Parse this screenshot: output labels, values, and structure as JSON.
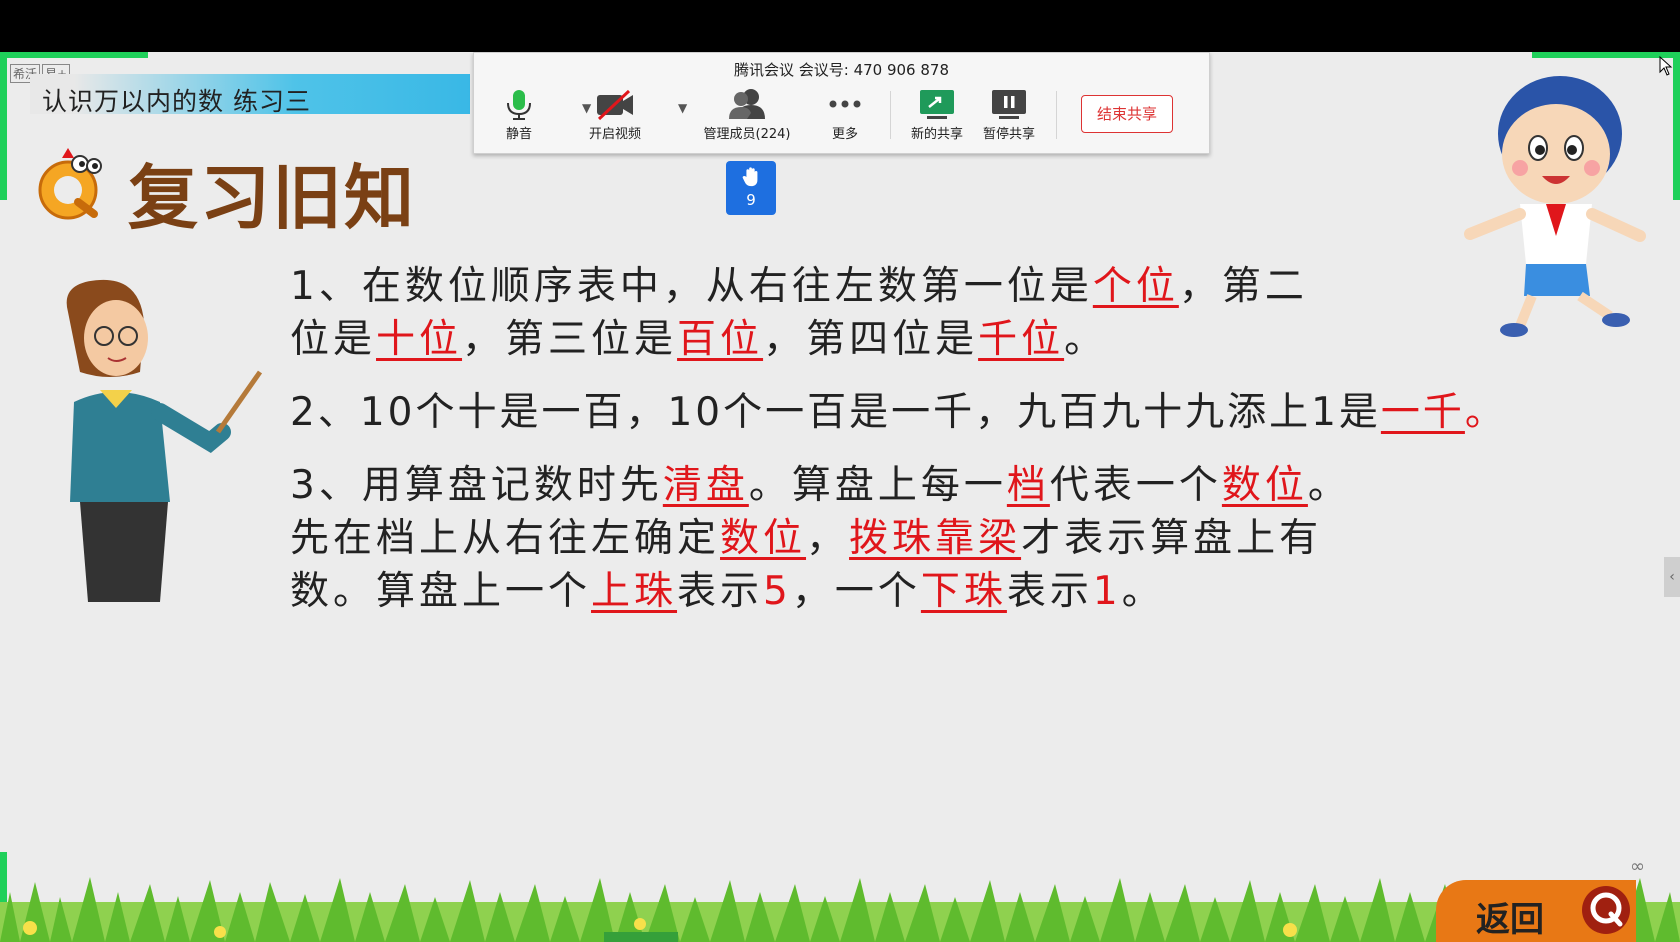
{
  "slide": {
    "logo_text": "希沃",
    "logo_badge": "易+",
    "lesson_title": "认识万以内的数  练习三",
    "section_title": "复习旧知",
    "paragraphs": {
      "p1": {
        "t1": "1、在数位顺序表中，从右往左数第一位是",
        "k1": "个位",
        "t2": "，第二",
        "t3": "位是",
        "k2": "十位",
        "t4": "，第三位是",
        "k3": "百位",
        "t5": "，第四位是",
        "k4": "千位",
        "t6": "。"
      },
      "p2": {
        "t1": "2、10个十是一百，10个一百是一千，九百九十九添上1是",
        "k1": "一千",
        "t2": "。"
      },
      "p3": {
        "t1": "3、用算盘记数时先",
        "k1": "清盘",
        "t2": "。算盘上每一",
        "k2": "档",
        "t3": "代表一个",
        "k3": "数位",
        "t4": "。",
        "t5": "先在档上从右往左确定",
        "k4": "数位",
        "t6": "，",
        "k5": "拨珠靠梁",
        "t7": "才表示算盘上有",
        "t8": "数。算盘上一个",
        "k6": "上珠",
        "t9": "表示",
        "n1": "5",
        "t10": "，一个",
        "k7": "下珠",
        "t11": "表示",
        "n2": "1",
        "t12": "。"
      }
    },
    "return_label": "返回"
  },
  "meeting": {
    "title": "腾讯会议 会议号: 470 906 878",
    "buttons": {
      "mute": "静音",
      "video": "开启视频",
      "members": "管理成员(224)",
      "more": "更多",
      "new_share": "新的共享",
      "pause_share": "暂停共享"
    },
    "end_share": "结束共享",
    "raised_hands": "9"
  },
  "colors": {
    "accent_red": "#e0161b",
    "meeting_blue": "#1e6fe0",
    "edge_green": "#1fd05a"
  }
}
